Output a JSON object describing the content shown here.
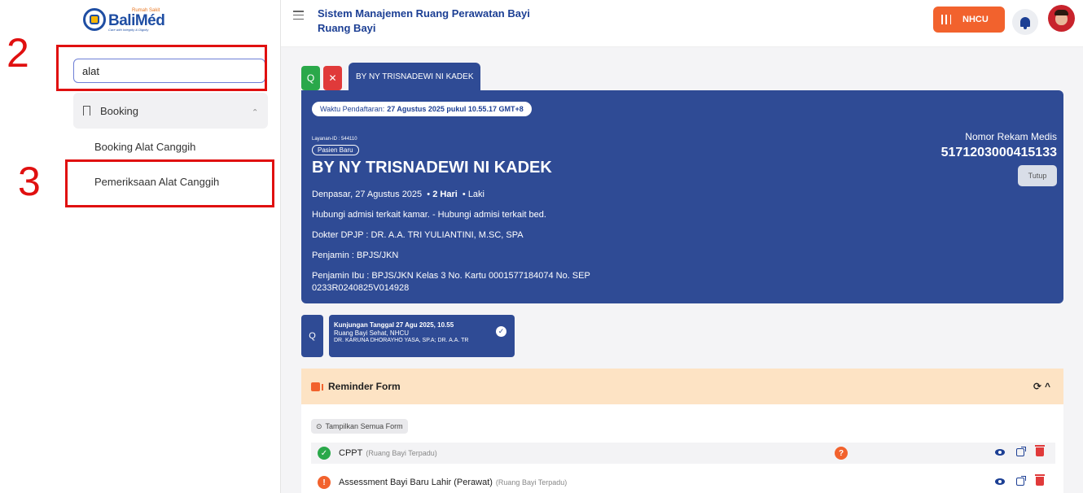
{
  "sidebar": {
    "logo": {
      "small": "Rumah Sakit",
      "main": "BaliMéd",
      "tagline": "Care with Integrity & Dignity"
    },
    "search": {
      "value": "alat"
    },
    "menu": {
      "label": "Booking"
    },
    "submenu": [
      {
        "label": "Booking Alat Canggih"
      },
      {
        "label": "Pemeriksaan Alat Canggih"
      }
    ]
  },
  "annotations": {
    "step_search": "2",
    "step_menu": "3",
    "color": "#e01010"
  },
  "header": {
    "title": "Sistem Manajemen Ruang Perawatan Bayi",
    "subtitle": "Ruang Bayi",
    "unit_button": "NHCU"
  },
  "tabs": {
    "search_icon": "Q",
    "close_icon": "✕",
    "active": "BY NY TRISNADEWI NI KADEK"
  },
  "patient": {
    "reg_prefix": "Waktu Pendaftaran:",
    "reg_time": "27 Agustus 2025 pukul 10.55.17 GMT+8",
    "layanan": "Layanan-ID : 544110",
    "status": "Pasien Baru",
    "name": "BY NY TRISNADEWI NI KADEK",
    "birth": "Denpasar, 27 Agustus 2025",
    "age": "2 Hari",
    "gender": "Laki",
    "contact": "Hubungi admisi terkait kamar. - Hubungi admisi terkait bed.",
    "doctor": "Dokter DPJP : DR. A.A. TRI YULIANTINI, M.SC, SPA",
    "guarantor": "Penjamin : BPJS/JKN",
    "mother_guarantor_1": "Penjamin Ibu : BPJS/JKN Kelas 3 No. Kartu 0001577184074 No. SEP",
    "mother_guarantor_2": "0233R0240825V014928",
    "mr_label": "Nomor Rekam Medis",
    "mr_number": "5171203000415133",
    "close_button": "Tutup"
  },
  "visit": {
    "title": "Kunjungan Tanggal 27 Agu 2025, 10.55",
    "room": "Ruang Bayi Sehat, NHCU",
    "doctors": "DR. KARUNA DHORAYHO YASA, SP.A; DR. A.A. TR"
  },
  "reminder": {
    "title": "Reminder Form",
    "show_all": "Tampilkan Semua Form",
    "rows": [
      {
        "status": "done",
        "name": "CPPT",
        "unit": "(Ruang Bayi Terpadu)"
      },
      {
        "status": "warning",
        "name": "Assessment Bayi Baru Lahir (Perawat)",
        "unit": "(Ruang Bayi Terpadu)"
      }
    ]
  },
  "colors": {
    "primary": "#2f4b95",
    "accent": "#f2622d",
    "success": "#2aa84a",
    "danger": "#e03a3a"
  }
}
